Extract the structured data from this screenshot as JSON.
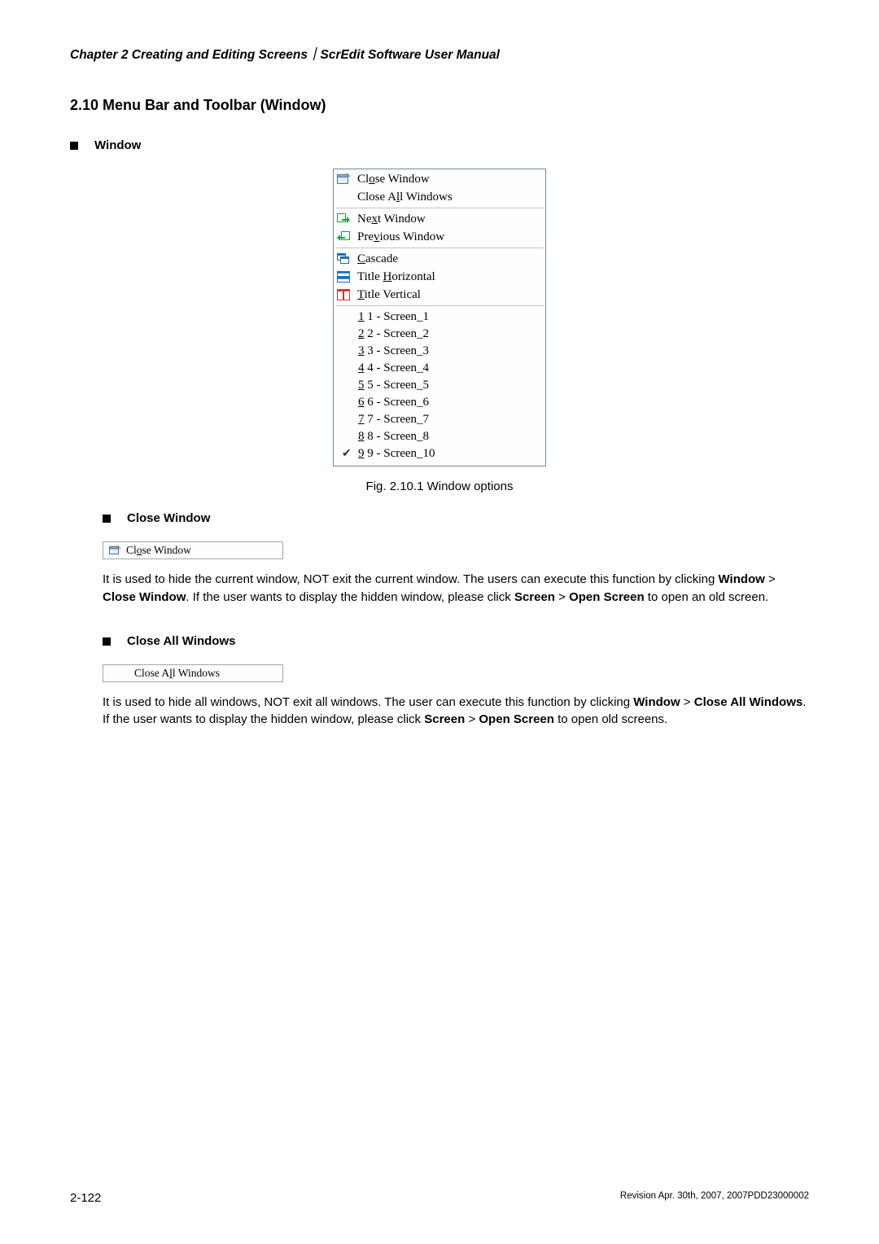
{
  "header": {
    "crumb": "Chapter 2  Creating and Editing Screens｜ScrEdit Software User Manual"
  },
  "section": {
    "number_title": "2.10   Menu Bar and Toolbar (Window)"
  },
  "window_label": "Window",
  "menu": {
    "groups": [
      {
        "items": [
          {
            "icon": "close-window-icon",
            "text": "Cl",
            "u": "o",
            "rest": "se Window"
          },
          {
            "icon": "",
            "text": "Close A",
            "u": "l",
            "rest": "l Windows"
          }
        ]
      },
      {
        "items": [
          {
            "icon": "next-window-icon",
            "text": "Ne",
            "u": "x",
            "rest": "t Window"
          },
          {
            "icon": "prev-window-icon",
            "text": "Pre",
            "u": "v",
            "rest": "ious Window"
          }
        ]
      },
      {
        "items": [
          {
            "icon": "cascade-icon",
            "text": "",
            "u": "C",
            "rest": "ascade"
          },
          {
            "icon": "tile-horizontal-icon",
            "text": "Title ",
            "u": "H",
            "rest": "orizontal"
          },
          {
            "icon": "tile-vertical-icon",
            "text": "",
            "u": "T",
            "rest": "itle Vertical"
          }
        ]
      }
    ],
    "screens": [
      {
        "chk": "",
        "u": "1",
        "rest": " 1 - Screen_1"
      },
      {
        "chk": "",
        "u": "2",
        "rest": " 2 - Screen_2"
      },
      {
        "chk": "",
        "u": "3",
        "rest": " 3 - Screen_3"
      },
      {
        "chk": "",
        "u": "4",
        "rest": " 4 - Screen_4"
      },
      {
        "chk": "",
        "u": "5",
        "rest": " 5 - Screen_5"
      },
      {
        "chk": "",
        "u": "6",
        "rest": " 6 - Screen_6"
      },
      {
        "chk": "",
        "u": "7",
        "rest": " 7 - Screen_7"
      },
      {
        "chk": "",
        "u": "8",
        "rest": " 8 - Screen_8"
      },
      {
        "chk": "✔",
        "u": "9",
        "rest": " 9 - Screen_10"
      }
    ]
  },
  "fig_caption": "Fig. 2.10.1 Window options",
  "sub1": {
    "title": "Close Window",
    "mini_text": "Cl",
    "mini_u": "o",
    "mini_rest": "se Window",
    "body_parts": {
      "p1a": "It is used to hide the current window, NOT exit the current window. The users can execute this function by clicking ",
      "b1": "Window",
      "sep1": " > ",
      "b2": "Close Window",
      "p1b": ". If the user wants to display the hidden window, please click ",
      "b3": "Screen",
      "sep2": " > ",
      "b4": "Open Screen",
      "p1c": " to open an old screen."
    }
  },
  "sub2": {
    "title": "Close All Windows",
    "mini_text": "Close A",
    "mini_u": "l",
    "mini_rest": "l Windows",
    "body_parts": {
      "p1a": "It is used to hide all windows, NOT exit all windows. The user can execute this function by clicking ",
      "b1": "Window",
      "sep1": " > ",
      "b2": "Close All Windows",
      "p1b": ". If the user wants to display the hidden window, please click ",
      "b3": "Screen",
      "sep2": " > ",
      "b4": "Open Screen",
      "p1c": " to open old screens."
    }
  },
  "footer": {
    "page": "2-122",
    "rev": "Revision Apr. 30th, 2007, 2007PDD23000002"
  }
}
